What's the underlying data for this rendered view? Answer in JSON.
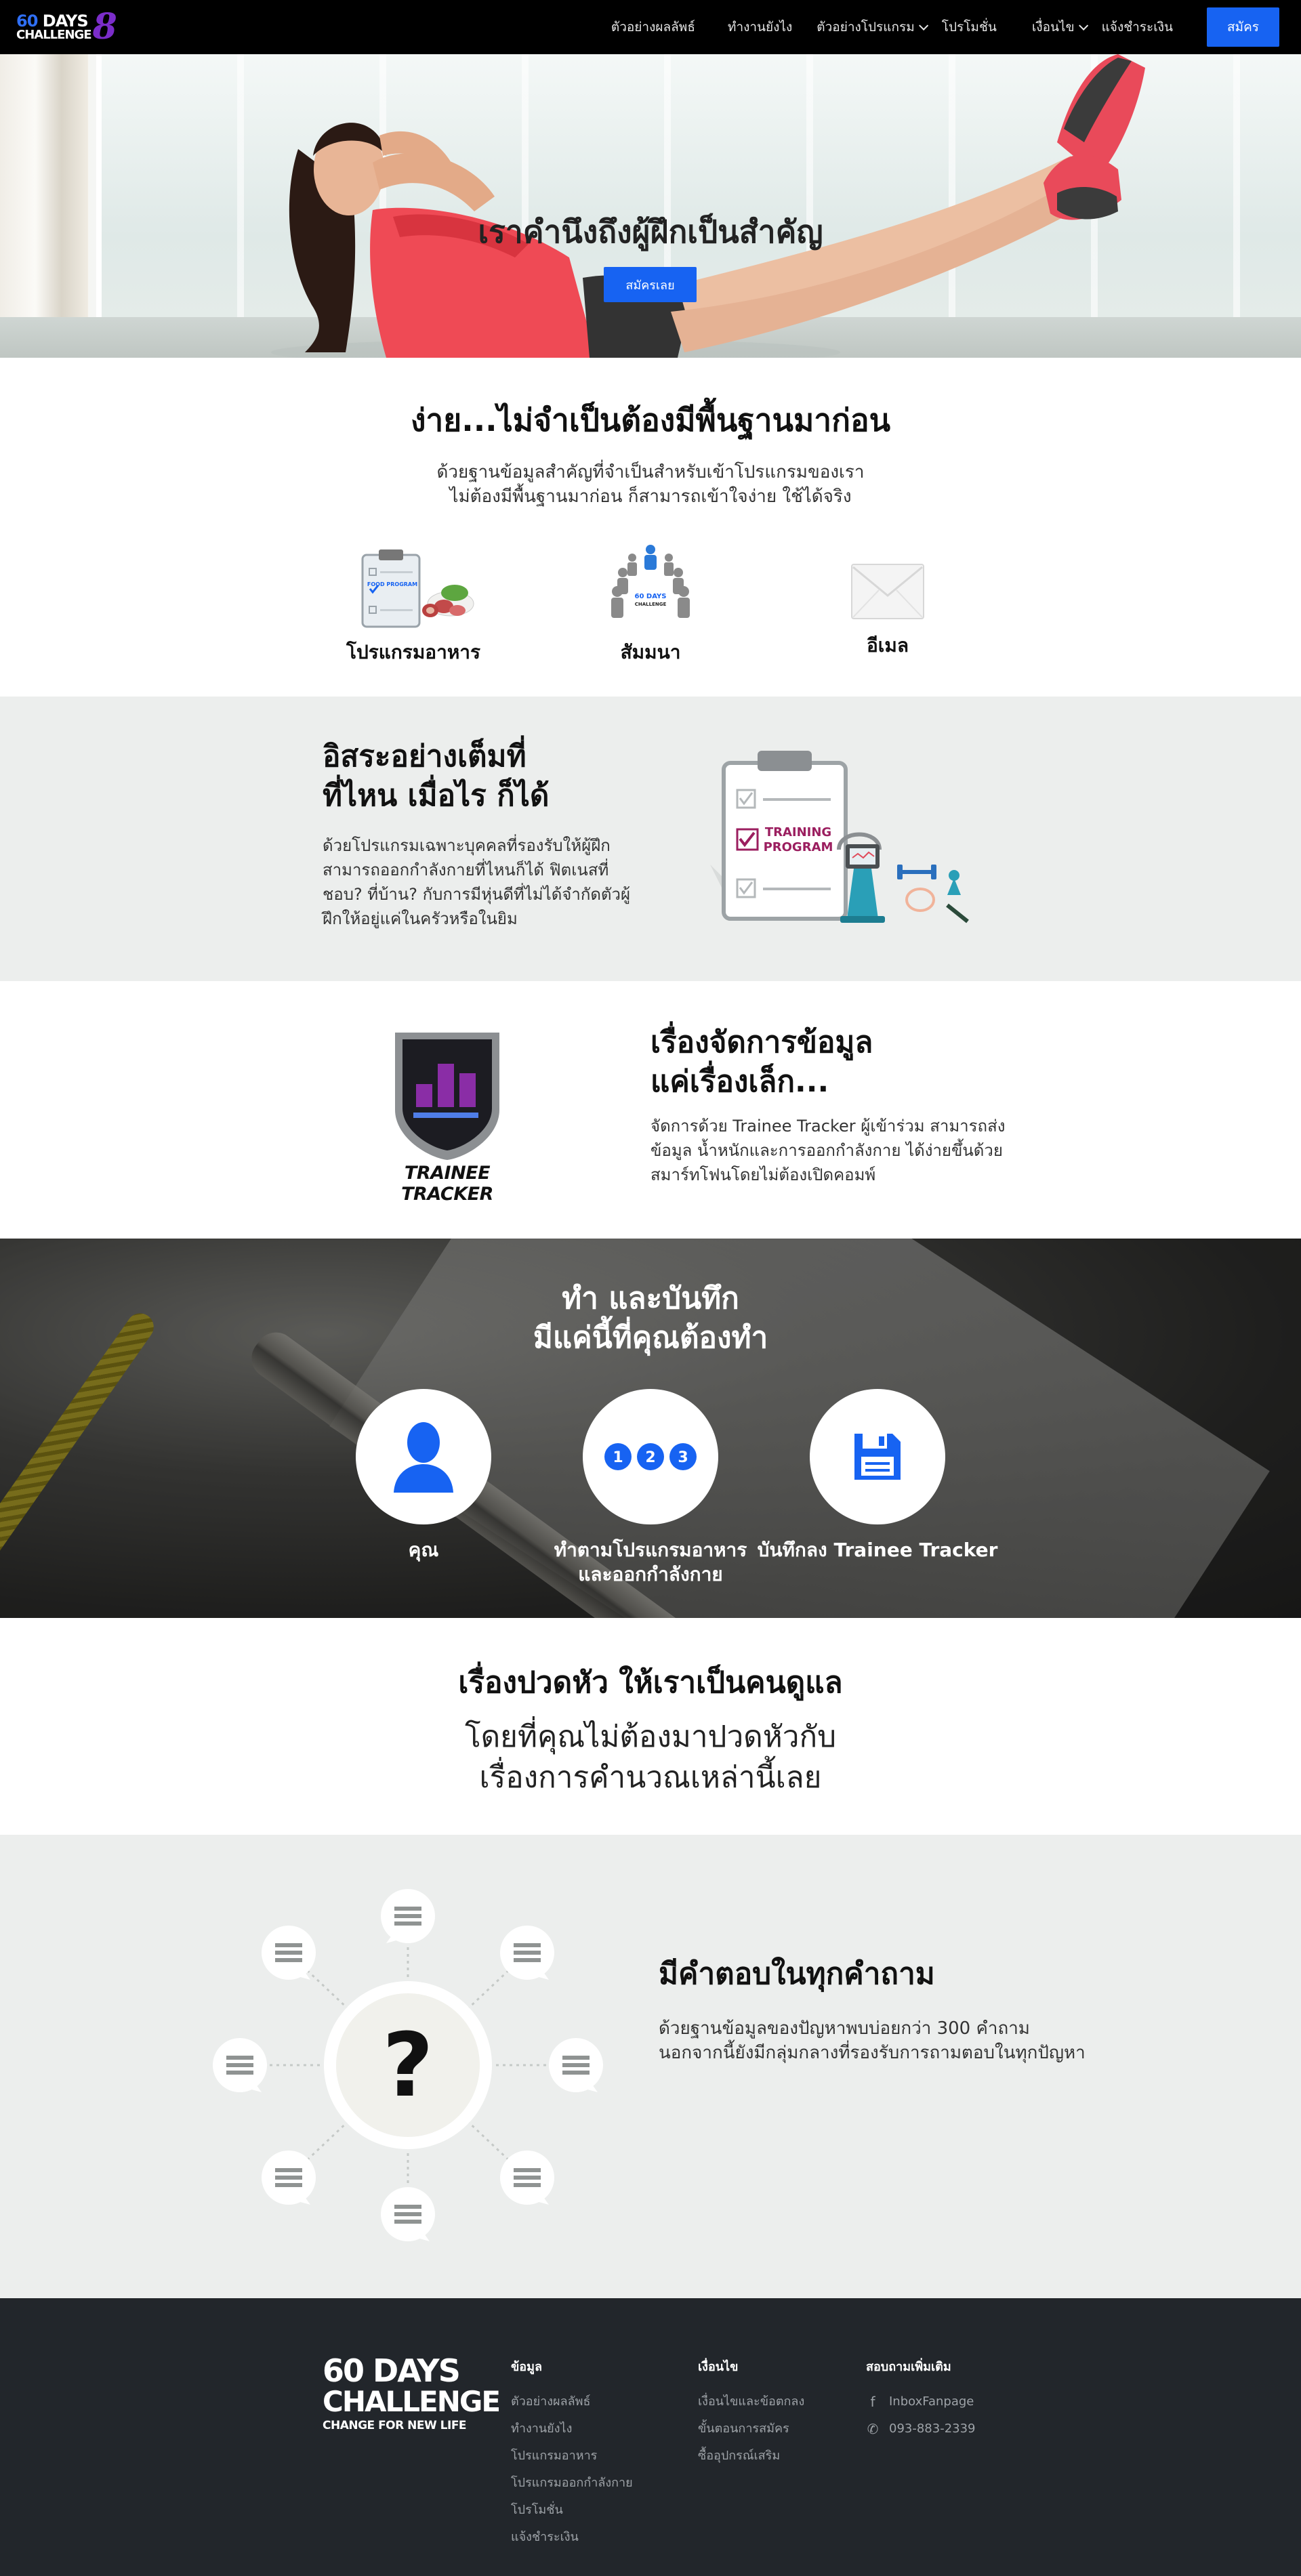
{
  "nav": {
    "logo": {
      "line1_num": "60",
      "line1_word": "DAYS",
      "line2": "CHALLENGE",
      "mark": "8"
    },
    "items": [
      {
        "label": "ตัวอย่างผลลัพธ์",
        "dropdown": false
      },
      {
        "label": "ทำงานยังไง",
        "dropdown": false
      },
      {
        "label": "ตัวอย่างโปรแกรม",
        "dropdown": true
      },
      {
        "label": "โปรโมชั่น",
        "dropdown": false
      },
      {
        "label": "เงื่อนไข",
        "dropdown": true
      },
      {
        "label": "แจ้งชำระเงิน",
        "dropdown": false
      }
    ],
    "signup_label": "สมัคร",
    "accent": "#1763f2"
  },
  "hero": {
    "title": "เราคำนึงถึงผู้ฝึกเป็นสำคัญ",
    "button_label": "สมัครเลย"
  },
  "easy": {
    "title": "ง่าย...ไม่จำเป็นต้องมีพื้นฐานมาก่อน",
    "subtitle_line1": "ด้วยฐานข้อมูลสำคัญที่จำเป็นสำหรับเข้าโปรแกรมของเรา",
    "subtitle_line2": "ไม่ต้องมีพื้นฐานมาก่อน ก็สามารถเข้าใจง่าย ใช้ได้จริง",
    "features": [
      {
        "label": "โปรแกรมอาหาร",
        "icon": "food-program-icon",
        "icon_text": "FOOD PROGRAM"
      },
      {
        "label": "สัมมนา",
        "icon": "seminar-icon",
        "icon_text_1": "60 DAYS",
        "icon_text_2": "CHALLENGE"
      },
      {
        "label": "อีเมล",
        "icon": "email-icon"
      }
    ]
  },
  "freedom": {
    "title_line1": "อิสระอย่างเต็มที่",
    "title_line2": "ที่ไหน เมื่อไร ก็ได้",
    "body": "ด้วยโปรแกรมเฉพาะบุคคลที่รองรับให้ผู้ฝึกสามารถออกกำลังกายที่ไหนก็ได้ ฟิตเนสที่ชอบ? ที่บ้าน? กับการมีหุ่นดีที่ไม่ได้จำกัดตัวผู้ฝึกให้อยู่แค่ในครัวหรือในยิม",
    "art_text_1": "TRAINING",
    "art_text_2": "PROGRAM"
  },
  "tracker": {
    "badge_label": "TRAINEE TRACKER",
    "title_line1": "เรื่องจัดการข้อมูล",
    "title_line2": "แค่เรื่องเล็ก...",
    "body": "จัดการด้วย Trainee Tracker ผู้เข้าร่วม สามารถส่งข้อมูล น้ำหนักและการออกกำลังกาย ได้ง่ายขึ้นด้วยสมาร์ทโฟนโดยไม่ต้องเปิดคอมพ์"
  },
  "steps": {
    "title_line1": "ทำ และบันทึก",
    "title_line2": "มีแค่นี้ที่คุณต้องทำ",
    "items": [
      {
        "label_line1": "คุณ",
        "label_line2": "",
        "icon": "user-icon"
      },
      {
        "label_line1": "ทำตามโปรแกรมอาหาร",
        "label_line2": "และออกกำลังกาย",
        "icon": "numbered-steps-icon",
        "numbers": [
          "1",
          "2",
          "3"
        ]
      },
      {
        "label_line1": "บันทึกลง Trainee Tracker",
        "label_line2": "",
        "icon": "save-icon"
      }
    ]
  },
  "worry": {
    "title": "เรื่องปวดหัว ให้เราเป็นคนดูแล",
    "line1": "โดยที่คุณไม่ต้องมาปวดหัวกับ",
    "line2": "เรื่องการคำนวณเหล่านี้เลย"
  },
  "faq": {
    "title": "มีคำตอบในทุกคำถาม",
    "body": "ด้วยฐานข้อมูลของปัญหาพบบ่อยกว่า 300 คำถาม นอกจากนี้ยังมีกลุ่มกลางที่รองรับการถามตอบในทุกปัญหา",
    "center_mark": "?"
  },
  "footer": {
    "logo_line1": "60 DAYS",
    "logo_line2": "CHALLENGE",
    "logo_line3": "CHANGE FOR NEW LIFE",
    "columns": [
      {
        "title": "ข้อมูล",
        "items": [
          "ตัวอย่างผลลัพธ์",
          "ทำงานยังไง",
          "โปรแกรมอาหาร",
          "โปรแกรมออกกำลังกาย",
          "โปรโมชั่น",
          "แจ้งชำระเงิน"
        ]
      },
      {
        "title": "เงื่อนไข",
        "items": [
          "เงื่อนไขและข้อตกลง",
          "ขั้นตอนการสมัคร",
          "ซื้ออุปกรณ์เสริม"
        ]
      },
      {
        "title": "สอบถามเพิ่มเติม",
        "items": [
          "InboxFanpage",
          "093-883-2339"
        ],
        "icons": [
          "facebook-icon",
          "phone-icon"
        ]
      }
    ]
  }
}
